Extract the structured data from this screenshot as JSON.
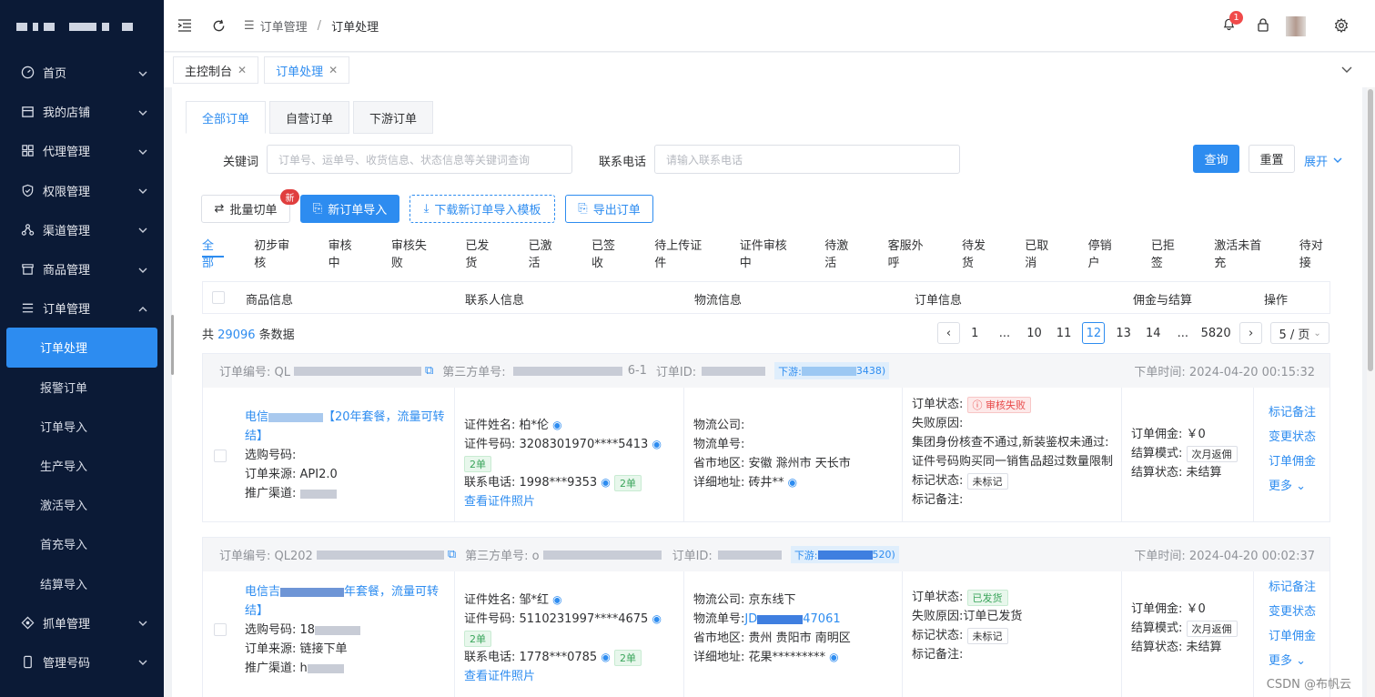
{
  "sidebar": {
    "items": [
      {
        "label": "首页",
        "icon": "dashboard-icon",
        "expanded": false
      },
      {
        "label": "我的店铺",
        "icon": "store-icon",
        "expanded": false
      },
      {
        "label": "代理管理",
        "icon": "grid-icon",
        "expanded": false
      },
      {
        "label": "权限管理",
        "icon": "shield-icon",
        "expanded": false
      },
      {
        "label": "渠道管理",
        "icon": "network-icon",
        "expanded": false
      },
      {
        "label": "商品管理",
        "icon": "shop-icon",
        "expanded": false
      },
      {
        "label": "订单管理",
        "icon": "list-icon",
        "expanded": true
      }
    ],
    "subitems": [
      "订单处理",
      "报警订单",
      "订单导入",
      "生产导入",
      "激活导入",
      "首充导入",
      "结算导入"
    ],
    "more": [
      {
        "label": "抓单管理",
        "icon": "target-icon"
      },
      {
        "label": "管理号码",
        "icon": "phone-icon"
      }
    ]
  },
  "topbar": {
    "breadcrumb": [
      "订单管理",
      "订单处理"
    ],
    "notification_count": "1"
  },
  "tabs": [
    {
      "label": "主控制台"
    },
    {
      "label": "订单处理"
    }
  ],
  "subtabs": [
    "全部订单",
    "自营订单",
    "下游订单"
  ],
  "filters": {
    "keyword_label": "关键词",
    "keyword_placeholder": "订单号、运单号、收货信息、状态信息等关键词查询",
    "phone_label": "联系电话",
    "phone_placeholder": "请输入联系电话",
    "search": "查询",
    "reset": "重置",
    "expand": "展开"
  },
  "actions": {
    "batch": "批量切单",
    "new_badge": "新",
    "import": "新订单导入",
    "download": "下载新订单导入模板",
    "export": "导出订单"
  },
  "status_tabs": [
    "全部",
    "初步审核",
    "审核中",
    "审核失败",
    "已发货",
    "已激活",
    "已签收",
    "待上传证件",
    "证件审核中",
    "待激活",
    "客服外呼",
    "待发货",
    "已取消",
    "停销户",
    "已拒签",
    "激活未首充",
    "待对接"
  ],
  "table_headers": [
    "商品信息",
    "联系人信息",
    "物流信息",
    "订单信息",
    "佣金与结算",
    "操作"
  ],
  "summary": {
    "prefix": "共",
    "count": "29096",
    "suffix": "条数据"
  },
  "pager": {
    "pages": [
      "1",
      "...",
      "10",
      "11",
      "12",
      "13",
      "14",
      "...",
      "5820"
    ],
    "active": "12",
    "size": "5 / 页"
  },
  "orders": [
    {
      "no_label": "订单编号: QL",
      "third_label": "第三方单号:",
      "third_tail": "6-1",
      "id_label": "订单ID:",
      "downstream": "下游: ",
      "ds_tail": "3438)",
      "time": "下单时间: 2024-04-20 00:15:32",
      "product": [
        "电信",
        "【20年套餐，流量可转结】"
      ],
      "select_no": "选购号码:",
      "source": "订单来源: API2.0",
      "channel": "推广渠道:",
      "cert_name": "证件姓名: 柏*伦",
      "cert_no": "证件号码: 3208301970****5413",
      "cert_tag": "2单",
      "phone": "联系电话: 1998***9353",
      "phone_tag": "2单",
      "photo": "查看证件照片",
      "logistics_co": "物流公司:",
      "logistics_no": "物流单号:",
      "region": "省市地区: 安徽 滁州市 天长市",
      "address": "详细地址: 砖井**",
      "status_label": "订单状态:",
      "status": "审核失败",
      "fail_label": "失败原因:",
      "fail_reason": "集团身份核查不通过,新装鉴权未通过:证件号码购买同一销售品超过数量限制",
      "mark_label": "标记状态:",
      "mark": "未标记",
      "note_label": "标记备注:",
      "commission": "订单佣金: ￥0",
      "settle_mode_label": "结算模式:",
      "settle_mode": "次月返佣",
      "settle_state": "结算状态: 未结算",
      "ops": [
        "标记备注",
        "变更状态",
        "订单佣金",
        "更多"
      ]
    },
    {
      "no_label": "订单编号: QL202",
      "third_label": "第三方单号: o",
      "third_tail": "",
      "id_label": "订单ID:",
      "downstream": "下游: ",
      "ds_tail": "520)",
      "time": "下单时间: 2024-04-20 00:02:37",
      "product": [
        "电信吉",
        "年套餐，流量可转结】"
      ],
      "select_no": "选购号码: 18",
      "source": "订单来源: 链接下单",
      "channel": "推广渠道: h",
      "cert_name": "证件姓名: 邹*红",
      "cert_no": "证件号码: 5110231997****4675",
      "cert_tag": "2单",
      "phone": "联系电话: 1778***0785",
      "phone_tag": "2单",
      "photo": "查看证件照片",
      "logistics_co": "物流公司: 京东线下",
      "logistics_no_label": "物流单号:",
      "logistics_no": "JD",
      "logistics_tail": "47061",
      "region": "省市地区: 贵州 贵阳市 南明区",
      "address": "详细地址: 花果*********",
      "status_label": "订单状态:",
      "status": "已发货",
      "fail_label": "失败原因:",
      "fail_reason": "订单已发货",
      "mark_label": "标记状态:",
      "mark": "未标记",
      "note_label": "标记备注:",
      "commission": "订单佣金: ￥0",
      "settle_mode_label": "结算模式:",
      "settle_mode": "次月返佣",
      "settle_state": "结算状态: 未结算",
      "ops": [
        "标记备注",
        "变更状态",
        "订单佣金",
        "更多"
      ]
    }
  ],
  "watermark": "CSDN @布帆云",
  "colors": {
    "primary": "#2d8cf0",
    "sidebar": "#0b1a36"
  }
}
